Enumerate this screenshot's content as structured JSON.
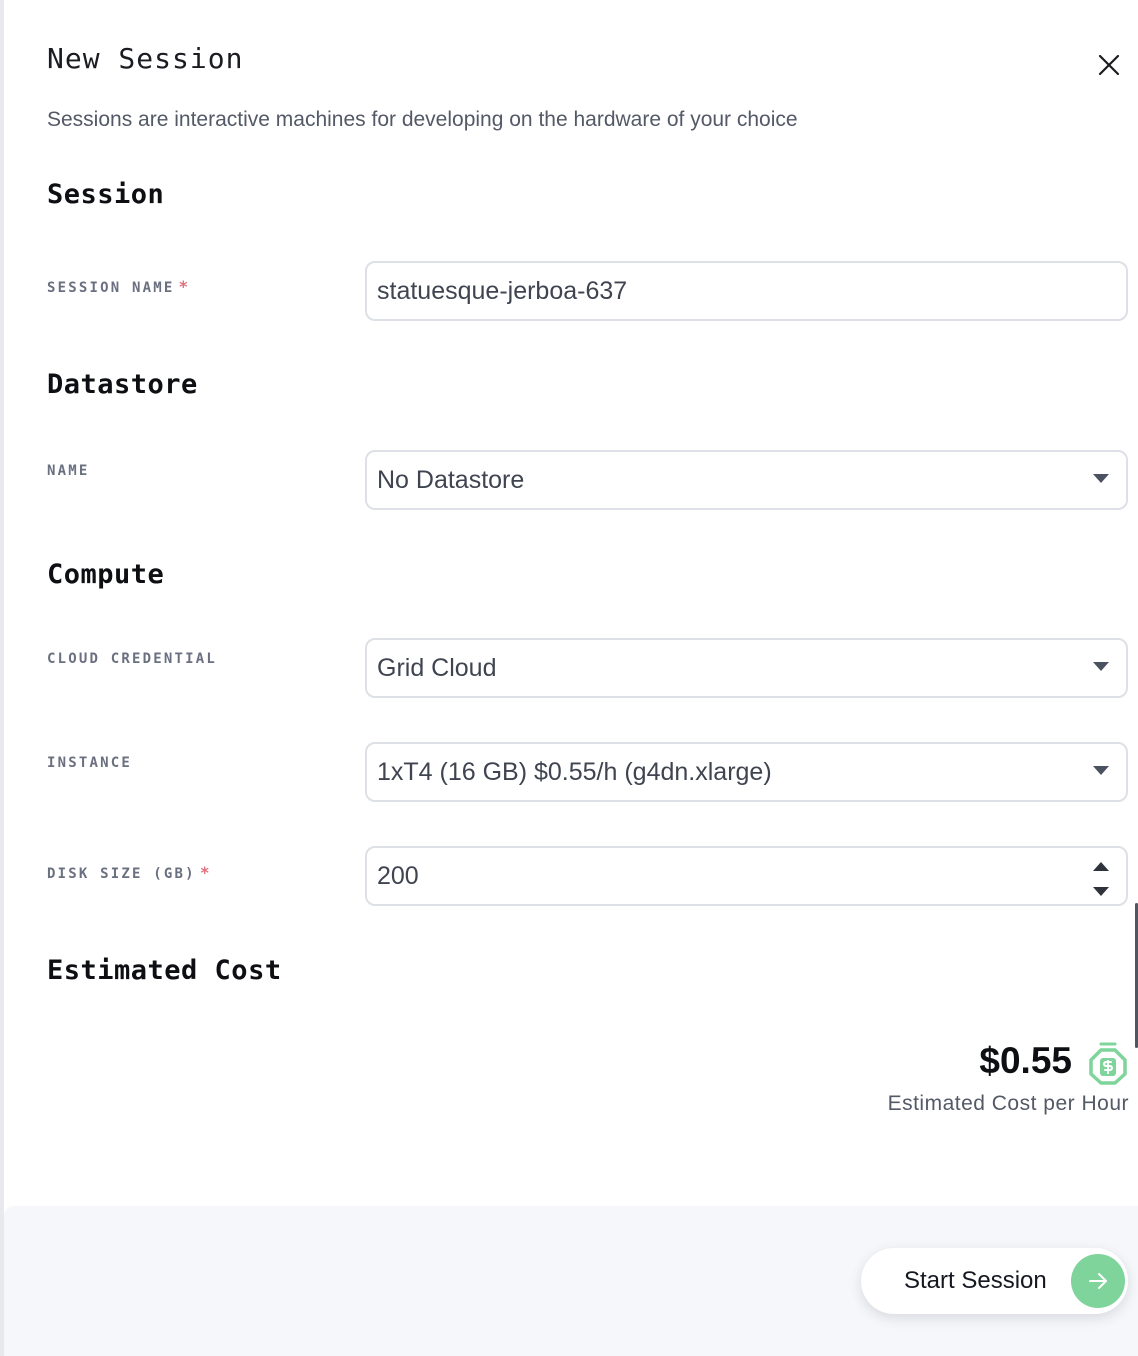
{
  "dialog": {
    "title": "New Session",
    "subtitle": "Sessions are interactive machines for developing on the hardware of your choice"
  },
  "sections": {
    "session": {
      "heading": "Session",
      "name_label": "SESSION NAME",
      "name_value": "statuesque-jerboa-637"
    },
    "datastore": {
      "heading": "Datastore",
      "name_label": "NAME",
      "name_selected": "No Datastore"
    },
    "compute": {
      "heading": "Compute",
      "credential_label": "CLOUD CREDENTIAL",
      "credential_selected": "Grid Cloud",
      "instance_label": "INSTANCE",
      "instance_selected": "1xT4 (16 GB) $0.55/h (g4dn.xlarge)",
      "disk_label": "DISK SIZE (GB)",
      "disk_value": "200"
    },
    "cost": {
      "heading": "Estimated Cost",
      "amount": "$0.55",
      "caption": "Estimated Cost per Hour"
    }
  },
  "required_marker": "*",
  "footer": {
    "start_label": "Start Session"
  },
  "icons": {
    "close": "close-icon",
    "dropdown": "chevron-down-icon",
    "cost": "stopwatch-dollar-icon",
    "start": "arrow-right-icon"
  },
  "colors": {
    "accent_green": "#7ed49a",
    "required_red": "#e0707d",
    "label_gray": "#6a7080",
    "footer_bg": "#f5f7fa"
  }
}
